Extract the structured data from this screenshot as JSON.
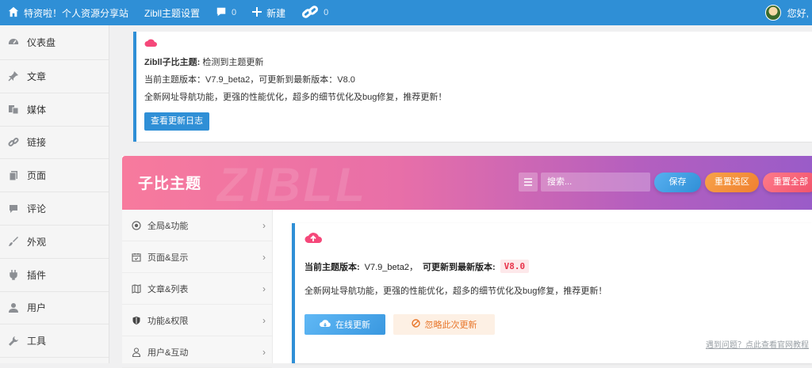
{
  "adminbar": {
    "site_name": "特资啦！个人资源分享站",
    "theme_settings": "Zibll主题设置",
    "comments_count": "0",
    "new_label": "新建",
    "links_count": "0",
    "greeting": "您好,"
  },
  "menu": {
    "items": [
      {
        "label": "仪表盘",
        "icon": "dashboard-icon"
      },
      {
        "label": "文章",
        "icon": "pin-icon"
      },
      {
        "label": "媒体",
        "icon": "media-icon"
      },
      {
        "label": "链接",
        "icon": "link-icon"
      },
      {
        "label": "页面",
        "icon": "page-icon"
      },
      {
        "label": "评论",
        "icon": "comment-icon"
      },
      {
        "label": "外观",
        "icon": "brush-icon"
      },
      {
        "label": "插件",
        "icon": "plugin-icon"
      },
      {
        "label": "用户",
        "icon": "user-icon"
      },
      {
        "label": "工具",
        "icon": "wrench-icon"
      }
    ]
  },
  "notice": {
    "title_bold": "Zibll子比主题:",
    "title_rest": " 检测到主题更新",
    "version_line": "当前主题版本：V7.9_beta2，可更新到最新版本：V8.0",
    "desc": "全新网址导航功能，更强的性能优化，超多的细节优化及bug修复，推荐更新！",
    "button": "查看更新日志"
  },
  "banner": {
    "title": "子比主题",
    "watermark": "ZIBLL",
    "search_placeholder": "搜索...",
    "save": "保存",
    "reset_section": "重置选区",
    "reset_all": "重置全部"
  },
  "subnav": {
    "items": [
      {
        "label": "全局&功能",
        "icon": "target-icon"
      },
      {
        "label": "页面&显示",
        "icon": "calendar-icon"
      },
      {
        "label": "文章&列表",
        "icon": "map-icon"
      },
      {
        "label": "功能&权限",
        "icon": "shield-icon"
      },
      {
        "label": "用户&互动",
        "icon": "user-outline-icon"
      }
    ],
    "chevron": "›"
  },
  "update": {
    "current_label": "当前主题版本:",
    "current_version": " V7.9_beta2，",
    "latest_label": "可更新到最新版本:",
    "latest_version": "V8.0",
    "desc": "全新网址导航功能，更强的性能优化，超多的细节优化及bug修复，推荐更新！",
    "online_btn": "在线更新",
    "ignore_btn": "忽略此次更新",
    "help_link": "遇到问题？点此查看官网教程"
  }
}
